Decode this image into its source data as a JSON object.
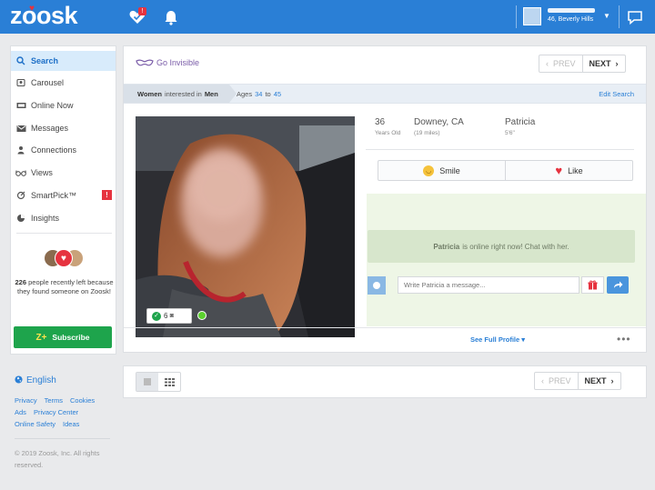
{
  "brand": {
    "logo_text": "zoosk",
    "accent": "#2a7fd6",
    "heart_color": "#e6333f"
  },
  "topbar": {
    "notification_badge": "!",
    "user_location": "46, Beverly Hills",
    "icons": [
      "heart-check-icon",
      "bell-icon",
      "user-avatar-icon",
      "chevron-down-icon",
      "chat-bubble-icon"
    ]
  },
  "sidebar": {
    "items": [
      {
        "label": "Search",
        "icon": "search-icon",
        "active": true
      },
      {
        "label": "Carousel",
        "icon": "carousel-icon"
      },
      {
        "label": "Online Now",
        "icon": "online-icon"
      },
      {
        "label": "Messages",
        "icon": "envelope-icon"
      },
      {
        "label": "Connections",
        "icon": "connections-icon"
      },
      {
        "label": "Views",
        "icon": "glasses-icon"
      },
      {
        "label": "SmartPick™",
        "icon": "smartpick-icon",
        "badge": "!"
      },
      {
        "label": "Insights",
        "icon": "insights-icon"
      }
    ],
    "promo_count": "226",
    "promo_text": " people recently left because they found someone on Zoosk!",
    "subscribe_icon": "Z+",
    "subscribe_label": "Subscribe"
  },
  "footer": {
    "language": "English",
    "links_row1": [
      "Privacy",
      "Terms",
      "Cookies"
    ],
    "links_row2": [
      "Ads",
      "Privacy Center"
    ],
    "links_row3": [
      "Online Safety",
      "Ideas"
    ],
    "copyright": "© 2019 Zoosk, Inc. All rights reserved."
  },
  "main": {
    "go_invisible": "Go Invisible",
    "prev": "PREV",
    "next": "NEXT",
    "filter": {
      "seg1_a": "Women",
      "seg1_b": "interested in",
      "seg1_c": "Men",
      "ages_prefix": "Ages",
      "age_min": "34",
      "age_to": "to",
      "age_max": "45",
      "edit": "Edit Search"
    },
    "profile": {
      "age": "36",
      "age_sub": "Years Old",
      "location": "Downey, CA",
      "distance": "(19 miles)",
      "name": "Patricia",
      "height": "5'6\""
    },
    "photo_count": "6",
    "actions": {
      "smile": "Smile",
      "like": "Like"
    },
    "online_name": "Patricia",
    "online_text": "is online right now! Chat with her.",
    "message_placeholder": "Write Patricia a message...",
    "see_full_profile": "See Full Profile",
    "more": "•••"
  },
  "bottom": {
    "prev": "PREV",
    "next": "NEXT"
  }
}
